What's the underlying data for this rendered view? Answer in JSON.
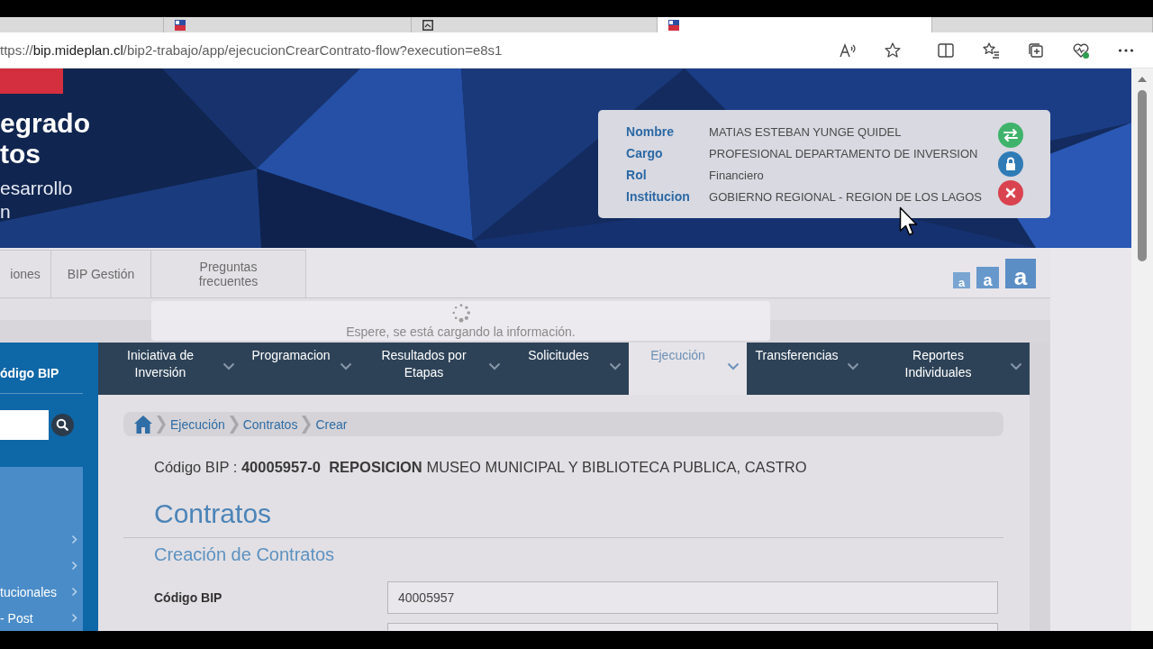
{
  "browser": {
    "tabs": [
      {
        "kind": "none",
        "selected": false
      },
      {
        "kind": "flag",
        "selected": false
      },
      {
        "kind": "page",
        "selected": false
      },
      {
        "kind": "flag",
        "selected": true
      },
      {
        "kind": "none",
        "selected": false
      }
    ],
    "address": {
      "scheme": "ttps://",
      "host": "bip.mideplan.cl",
      "path": "/bip2-trabajo/app/ejecucionCrearContrato-flow?execution=e8s1"
    }
  },
  "header": {
    "title_lines": [
      "egrado",
      "tos"
    ],
    "subtitle_lines": [
      "esarrollo",
      "n"
    ],
    "user": {
      "rows": [
        {
          "label": "Nombre",
          "value": "MATIAS ESTEBAN YUNGE QUIDEL"
        },
        {
          "label": "Cargo",
          "value": "PROFESIONAL DEPARTAMENTO DE INVERSION"
        },
        {
          "label": "Rol",
          "value": "Financiero"
        },
        {
          "label": "Institucion",
          "value": "GOBIERNO REGIONAL - REGION DE LOS LAGOS"
        }
      ],
      "actions": [
        {
          "kind": "switch"
        },
        {
          "kind": "lock"
        },
        {
          "kind": "close"
        }
      ]
    }
  },
  "top_tabs": [
    {
      "label": "iones"
    },
    {
      "label": "BIP Gestión"
    },
    {
      "label": "Preguntas frecuentes"
    }
  ],
  "text_size_buttons": [
    {
      "label": "a"
    },
    {
      "label": "a"
    },
    {
      "label": "a"
    }
  ],
  "loading": {
    "message": "Espere, se está cargando la información."
  },
  "sidebar": {
    "title": "ódigo BIP",
    "items": [
      {
        "submenu": true
      },
      {
        "submenu": true
      },
      {
        "label": "tucionales",
        "submenu": true
      },
      {
        "label": "- Post",
        "submenu": true
      }
    ]
  },
  "nav": [
    {
      "label": "Iniciativa de Inversión",
      "selected": false
    },
    {
      "label": "Programacion",
      "selected": false
    },
    {
      "label": "Resultados por Etapas",
      "selected": false
    },
    {
      "label": "Solicitudes",
      "selected": false
    },
    {
      "label": "Ejecución",
      "selected": true
    },
    {
      "label": "Transferencias",
      "selected": false
    },
    {
      "label": "Reportes Individuales",
      "selected": false
    }
  ],
  "breadcrumb": [
    "Ejecución",
    "Contratos",
    "Crear"
  ],
  "project_line": "Código BIP : **40005957-0**  **REPOSICION** MUSEO MUNICIPAL Y BIBLIOTECA PUBLICA, CASTRO",
  "page_title": "Contratos",
  "section_title": "Creación de Contratos",
  "form": [
    {
      "kind": "text",
      "label": "Código BIP",
      "value": "40005957"
    },
    {
      "kind": "text"
    }
  ]
}
